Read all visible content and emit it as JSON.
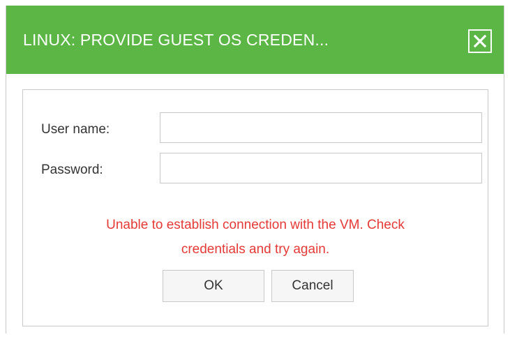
{
  "dialog": {
    "title": "LINUX: PROVIDE GUEST OS CREDEN...",
    "close_icon": "close-icon"
  },
  "form": {
    "username_label": "User name:",
    "username_value": "",
    "password_label": "Password:",
    "password_value": ""
  },
  "error": {
    "line1": "Unable to establish connection with the VM. Check",
    "line2": "credentials and try again.",
    "color": "#e53935"
  },
  "buttons": {
    "ok_label": "OK",
    "cancel_label": "Cancel"
  },
  "colors": {
    "titlebar": "#5cb646"
  }
}
